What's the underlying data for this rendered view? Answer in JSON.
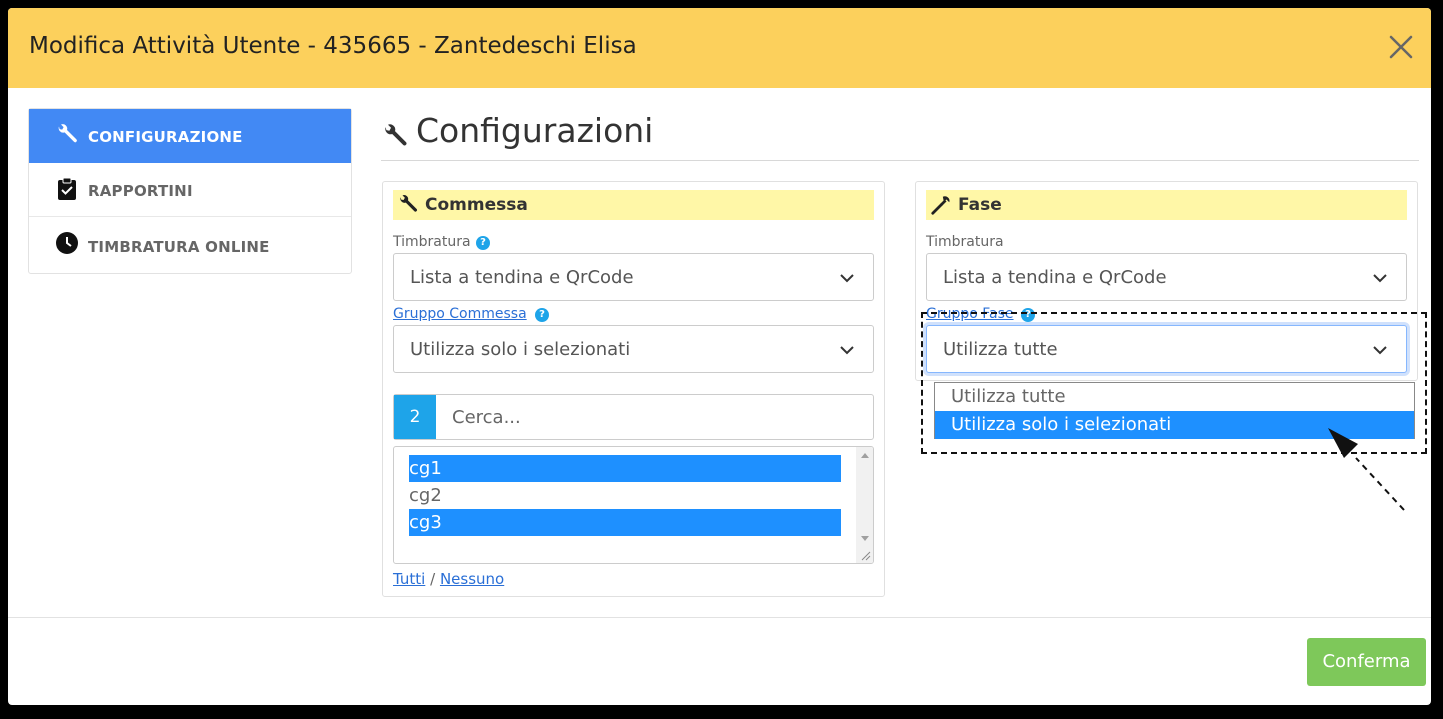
{
  "header": {
    "title": "Modifica Attività Utente - 435665 - Zantedeschi Elisa"
  },
  "sidebar": {
    "items": [
      {
        "label": "CONFIGURAZIONE",
        "icon": "wrench-icon",
        "active": true
      },
      {
        "label": "RAPPORTINI",
        "icon": "clipboard-check-icon",
        "active": false
      },
      {
        "label": "TIMBRATURA ONLINE",
        "icon": "clock-icon",
        "active": false
      }
    ]
  },
  "main": {
    "title": "Configurazioni",
    "commessa": {
      "heading": "Commessa",
      "timbratura_label": "Timbratura",
      "timbratura_value": "Lista a tendina e QrCode",
      "gruppo_label": "Gruppo Commessa",
      "gruppo_value": "Utilizza solo i selezionati",
      "selected_count": "2",
      "search_placeholder": "Cerca...",
      "options": [
        {
          "label": "cg1",
          "selected": true
        },
        {
          "label": "cg2",
          "selected": false
        },
        {
          "label": "cg3",
          "selected": true
        }
      ],
      "link_all": "Tutti",
      "link_separator": "/",
      "link_none": "Nessuno"
    },
    "fase": {
      "heading": "Fase",
      "timbratura_label": "Timbratura",
      "timbratura_value": "Lista a tendina e QrCode",
      "gruppo_label": "Gruppo Fase",
      "gruppo_value": "Utilizza tutte",
      "dropdown_options": [
        {
          "label": "Utilizza tutte",
          "highlighted": false
        },
        {
          "label": "Utilizza solo i selezionati",
          "highlighted": true
        }
      ]
    }
  },
  "footer": {
    "confirm_label": "Conferma"
  },
  "colors": {
    "header_bg": "#fcd05c",
    "active_nav": "#4289f4",
    "panel_heading_bg": "#fff7a7",
    "selected_option": "#1e90ff",
    "confirm": "#7ec85a",
    "help_badge": "#1ea4e9"
  }
}
